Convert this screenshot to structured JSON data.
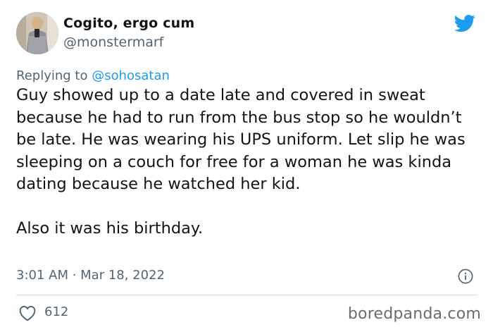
{
  "author": {
    "name": "Cogito, ergo cum",
    "handle": "@monstermarf"
  },
  "reply": {
    "prefix": "Replying to ",
    "mention": "@sohosatan"
  },
  "tweet": {
    "text": "Guy showed up to a date late and covered in sweat because he had to run from the bus stop so he wouldn’t be late. He was wearing his UPS uniform. Let slip he was sleeping on a couch for free for a woman he was kinda dating because he watched her kid.\n\nAlso it was his birthday.",
    "timestamp": "3:01 AM · Mar 18, 2022",
    "like_count": "612"
  },
  "watermark": "boredpanda.com",
  "icons": {
    "platform": "twitter-bird-icon",
    "info": "info-icon",
    "like": "heart-icon"
  },
  "colors": {
    "accent": "#1d9bf0",
    "secondary_text": "#536471",
    "divider": "#cfd9de"
  }
}
